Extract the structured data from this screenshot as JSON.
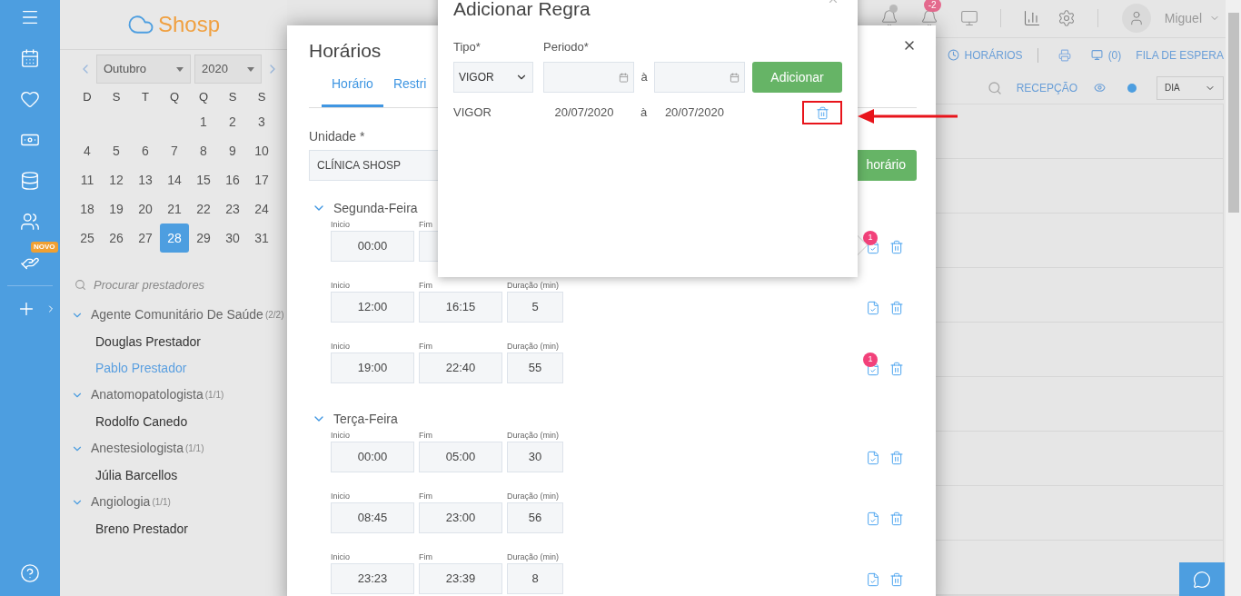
{
  "sidebar": {
    "badge": "NOVO"
  },
  "logo": {
    "name": "Shosp"
  },
  "calendar": {
    "month": "Outubro",
    "year": "2020",
    "weekdays": [
      "D",
      "S",
      "T",
      "Q",
      "Q",
      "S",
      "S"
    ],
    "weeks": [
      [
        {
          "day": "1",
          "selected": false
        },
        {
          "day": "2",
          "selected": false
        },
        {
          "day": "3",
          "selected": false
        }
      ],
      [
        {
          "day": "4",
          "selected": false
        },
        {
          "day": "5",
          "selected": false
        },
        {
          "day": "6",
          "selected": false
        },
        {
          "day": "7",
          "selected": false
        },
        {
          "day": "8",
          "selected": false
        },
        {
          "day": "9",
          "selected": false
        },
        {
          "day": "10",
          "selected": false
        }
      ],
      [
        {
          "day": "11",
          "selected": false
        },
        {
          "day": "12",
          "selected": false
        },
        {
          "day": "13",
          "selected": false
        },
        {
          "day": "14",
          "selected": false
        },
        {
          "day": "15",
          "selected": false
        },
        {
          "day": "16",
          "selected": false
        },
        {
          "day": "17",
          "selected": false
        }
      ],
      [
        {
          "day": "18",
          "selected": false
        },
        {
          "day": "19",
          "selected": false
        },
        {
          "day": "20",
          "selected": false
        },
        {
          "day": "21",
          "selected": false
        },
        {
          "day": "22",
          "selected": false
        },
        {
          "day": "23",
          "selected": false
        },
        {
          "day": "24",
          "selected": false
        }
      ],
      [
        {
          "day": "25",
          "selected": false
        },
        {
          "day": "26",
          "selected": false
        },
        {
          "day": "27",
          "selected": false
        },
        {
          "day": "28",
          "selected": true
        },
        {
          "day": "29",
          "selected": false
        },
        {
          "day": "30",
          "selected": false
        },
        {
          "day": "31",
          "selected": false
        }
      ]
    ]
  },
  "search": {
    "placeholder": "Procurar prestadores"
  },
  "providers": [
    {
      "name": "Agente Comunitário De Saúde",
      "count": "(2/2)",
      "expanded": true,
      "children": [
        {
          "name": "Douglas Prestador",
          "selected": false
        },
        {
          "name": "Pablo Prestador",
          "selected": true
        }
      ]
    },
    {
      "name": "Anatomopatologista",
      "count": "(1/1)",
      "expanded": true,
      "children": [
        {
          "name": "Rodolfo Canedo",
          "selected": false
        }
      ]
    },
    {
      "name": "Anestesiologista",
      "count": "(1/1)",
      "expanded": true,
      "children": [
        {
          "name": "Júlia Barcellos",
          "selected": false
        }
      ]
    },
    {
      "name": "Angiologia",
      "count": "(1/1)",
      "expanded": true,
      "children": [
        {
          "name": "Breno Prestador",
          "selected": false
        }
      ]
    }
  ],
  "header": {
    "alert_badge": "-2",
    "user": "Miguel"
  },
  "toolbar": {
    "schedules": "HORÁRIOS",
    "screen_count": "(0)",
    "waiting_list": "FILA DE ESPERA",
    "reception": "RECEPÇÃO",
    "view": "DIA"
  },
  "horarios_modal": {
    "title": "Horários",
    "tabs": [
      {
        "label": "Horário",
        "selected": true
      },
      {
        "label": "Restri",
        "selected": false
      }
    ],
    "unit_label": "Unidade *",
    "unit_value": "CLÍNICA SHOSP",
    "add_button": "horário",
    "days": [
      {
        "name": "Segunda-Feira",
        "expanded": true,
        "slots": [
          {
            "start_label": "Inicio",
            "start": "00:00",
            "end_label": "Fim",
            "badge": "1"
          },
          {
            "start_label": "Inicio",
            "start": "12:00",
            "end_label": "Fim",
            "end": "16:15",
            "duration_label": "Duração (min)",
            "duration": "5"
          },
          {
            "start_label": "Inicio",
            "start": "19:00",
            "end_label": "Fim",
            "end": "22:40",
            "duration_label": "Duração (min)",
            "duration": "55",
            "badge": "1"
          }
        ]
      },
      {
        "name": "Terça-Feira",
        "expanded": true,
        "slots": [
          {
            "start_label": "Inicio",
            "start": "00:00",
            "end_label": "Fim",
            "end": "05:00",
            "duration_label": "Duração (min)",
            "duration": "30"
          },
          {
            "start_label": "Inicio",
            "start": "08:45",
            "end_label": "Fim",
            "end": "23:00",
            "duration_label": "Duração (min)",
            "duration": "56"
          },
          {
            "start_label": "Inicio",
            "start": "23:23",
            "end_label": "Fim",
            "end": "23:39",
            "duration_label": "Duração (min)",
            "duration": "8"
          }
        ]
      }
    ]
  },
  "rule_modal": {
    "title": "Adicionar Regra",
    "type_label": "Tipo*",
    "period_label": "Periodo*",
    "type_value": "VIGOR",
    "between": "à",
    "add_button": "Adicionar",
    "rules": [
      {
        "type": "VIGOR",
        "from": "20/07/2020",
        "between": "à",
        "to": "20/07/2020",
        "highlighted": true
      }
    ]
  }
}
